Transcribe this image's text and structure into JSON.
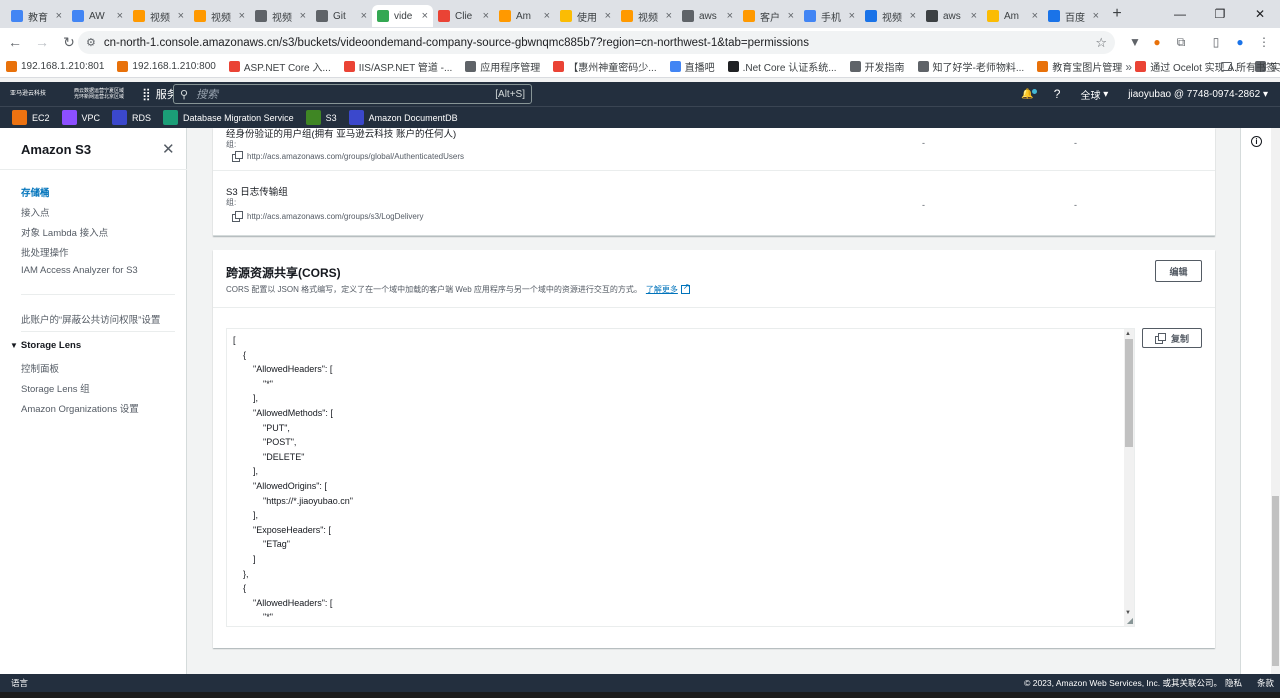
{
  "browser": {
    "tabs": [
      {
        "label": "教育",
        "color": "#4285f4"
      },
      {
        "label": "AW",
        "color": "#4285f4"
      },
      {
        "label": "视频",
        "color": "#ff9900"
      },
      {
        "label": "视频",
        "color": "#ff9900"
      },
      {
        "label": "视频",
        "color": "#5f6368"
      },
      {
        "label": "Git",
        "color": "#5f6368"
      },
      {
        "label": "vide",
        "color": "#34a853"
      },
      {
        "label": "Clie",
        "color": "#ea4335"
      },
      {
        "label": "Am",
        "color": "#ff9900"
      },
      {
        "label": "使用",
        "color": "#fbbc04"
      },
      {
        "label": "视频",
        "color": "#ff9900"
      },
      {
        "label": "aws",
        "color": "#5f6368"
      },
      {
        "label": "客户",
        "color": "#ff9900"
      },
      {
        "label": "手机",
        "color": "#4285f4"
      },
      {
        "label": "视频",
        "color": "#1a73e8"
      },
      {
        "label": "aws",
        "color": "#3c4043"
      },
      {
        "label": "Am",
        "color": "#fbbc04"
      },
      {
        "label": "百度",
        "color": "#1a73e8"
      }
    ],
    "active_tab": 6,
    "url": "cn-north-1.console.amazonaws.cn/s3/buckets/videoondemand-company-source-gbwnqmc885b7?region=cn-northwest-1&tab=permissions",
    "bookmarks": [
      {
        "label": "192.168.1.210:801",
        "color": "#e8710a"
      },
      {
        "label": "192.168.1.210:800",
        "color": "#e8710a"
      },
      {
        "label": "ASP.NET Core 入...",
        "color": "#ea4335"
      },
      {
        "label": "IIS/ASP.NET 管道 -...",
        "color": "#ea4335"
      },
      {
        "label": "应用程序管理",
        "color": "#5f6368"
      },
      {
        "label": "【惠州神童密码少...",
        "color": "#ea4335"
      },
      {
        "label": "直播吧",
        "color": "#4285f4"
      },
      {
        "label": ".Net Core 认证系统...",
        "color": "#202124"
      },
      {
        "label": "开发指南",
        "color": "#5f6368"
      },
      {
        "label": "知了好学-老师物料...",
        "color": "#5f6368"
      },
      {
        "label": "教育宝图片管理",
        "color": "#e8710a"
      },
      {
        "label": "通过 Ocelot 实现 A...",
        "color": "#ea4335"
      },
      {
        "label": "实体自动生成器",
        "color": "#5f6368"
      }
    ],
    "all_bookmarks": "所有书签"
  },
  "aws": {
    "logo_line1": "亚马逊云科技",
    "region_note_1": "西云数据运营宁夏区域",
    "region_note_2": "光环新网运营北京区域",
    "services_label": "服务",
    "search_placeholder": "搜索",
    "search_shortcut": "[Alt+S]",
    "region_menu": "全球",
    "account": "jiaoyubao @ 7748-0974-2862",
    "favorites": [
      {
        "label": "EC2",
        "color": "#ec7211"
      },
      {
        "label": "VPC",
        "color": "#8c4fff"
      },
      {
        "label": "RDS",
        "color": "#3b48cc"
      },
      {
        "label": "Database Migration Service",
        "color": "#1b9e77"
      },
      {
        "label": "S3",
        "color": "#3f8624"
      },
      {
        "label": "Amazon DocumentDB",
        "color": "#3b48cc"
      }
    ]
  },
  "sidebar": {
    "title": "Amazon S3",
    "links": [
      "存储桶",
      "接入点",
      "对象 Lambda 接入点",
      "批处理操作",
      "IAM Access Analyzer for S3"
    ],
    "block_public": "此账户的“屏蔽公共访问权限”设置",
    "storage_lens": "Storage Lens",
    "storage_links": [
      "控制面板",
      "Storage Lens 组",
      "Amazon Organizations 设置"
    ]
  },
  "acl": {
    "rows": [
      {
        "name": "经身份验证的用户组(拥有 亚马逊云科技 账户的任何人)",
        "label": "组:",
        "uri": "http://acs.amazonaws.com/groups/global/AuthenticatedUsers",
        "col1": "-",
        "col2": "-"
      },
      {
        "name": "S3 日志传输组",
        "label": "组:",
        "uri": "http://acs.amazonaws.com/groups/s3/LogDelivery",
        "col1": "-",
        "col2": "-"
      }
    ]
  },
  "cors": {
    "title": "跨源资源共享(CORS)",
    "description": "CORS 配置以 JSON 格式编写，定义了在一个域中加载的客户端 Web 应用程序与另一个域中的资源进行交互的方式。",
    "learn_more": "了解更多",
    "edit_label": "编辑",
    "copy_label": "复制",
    "code_lines": [
      "[",
      "    {",
      "        \"AllowedHeaders\": [",
      "            \"*\"",
      "        ],",
      "        \"AllowedMethods\": [",
      "            \"PUT\",",
      "            \"POST\",",
      "            \"DELETE\"",
      "        ],",
      "        \"AllowedOrigins\": [",
      "            \"https://*.jiaoyubao.cn\"",
      "        ],",
      "        \"ExposeHeaders\": [",
      "            \"ETag\"",
      "        ]",
      "    },",
      "    {",
      "        \"AllowedHeaders\": [",
      "            \"*\""
    ]
  },
  "footer": {
    "language": "语言",
    "copyright": "© 2023, Amazon Web Services, Inc. 或其关联公司。",
    "privacy": "隐私",
    "terms": "条款"
  }
}
